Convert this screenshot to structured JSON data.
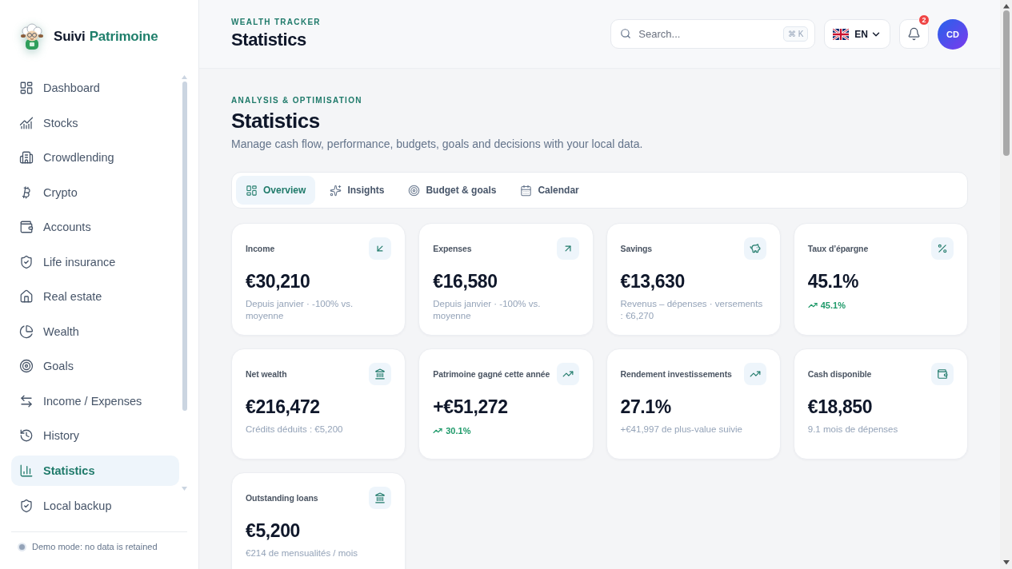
{
  "sidebar": {
    "brand": {
      "first": "Suivi",
      "second": "Patrimoine"
    },
    "nav": [
      {
        "label": "Dashboard",
        "selected": false
      },
      {
        "label": "Stocks",
        "selected": false
      },
      {
        "label": "Crowdlending",
        "selected": false
      },
      {
        "label": "Crypto",
        "selected": false
      },
      {
        "label": "Accounts",
        "selected": false
      },
      {
        "label": "Life insurance",
        "selected": false
      },
      {
        "label": "Real estate",
        "selected": false
      },
      {
        "label": "Wealth",
        "selected": false
      },
      {
        "label": "Goals",
        "selected": false
      },
      {
        "label": "Income / Expenses",
        "selected": false
      },
      {
        "label": "History",
        "selected": false
      },
      {
        "label": "Statistics",
        "selected": true
      }
    ],
    "backup_link": "Local backup",
    "demo_notice": "Demo mode: no data is retained"
  },
  "header": {
    "eyebrow": "WEALTH TRACKER",
    "title": "Statistics",
    "search": {
      "placeholder": "Search...",
      "shortcut": "⌘ K"
    },
    "language": "EN",
    "notifications": {
      "count": "2"
    },
    "avatar": "CD"
  },
  "page": {
    "eyebrow": "ANALYSIS & OPTIMISATION",
    "title": "Statistics",
    "subtitle": "Manage cash flow, performance, budgets, goals and decisions with your local data."
  },
  "tabs": [
    {
      "label": "Overview",
      "selected": true
    },
    {
      "label": "Insights",
      "selected": false
    },
    {
      "label": "Budget & goals",
      "selected": false
    },
    {
      "label": "Calendar",
      "selected": false
    }
  ],
  "cards": [
    {
      "kind": "note",
      "label": "Income",
      "value": "€30,210",
      "note": "Depuis janvier · -100% vs. moyenne"
    },
    {
      "kind": "note",
      "label": "Expenses",
      "value": "€16,580",
      "note": "Depuis janvier · -100% vs. moyenne"
    },
    {
      "kind": "note",
      "label": "Savings",
      "value": "€13,630",
      "note": "Revenus – dépenses · versements : €6,270"
    },
    {
      "kind": "trend",
      "label": "Taux d’épargne",
      "value": "45.1%",
      "trend": "45.1%"
    },
    {
      "kind": "note",
      "label": "Net wealth",
      "value": "€216,472",
      "note": "Crédits déduits : €5,200"
    },
    {
      "kind": "trend",
      "label": "Patrimoine gagné cette année",
      "value": "+€51,272",
      "trend": "30.1%"
    },
    {
      "kind": "note",
      "label": "Rendement investissements",
      "value": "27.1%",
      "note": "+€41,997 de plus-value suivie"
    },
    {
      "kind": "note",
      "label": "Cash disponible",
      "value": "€18,850",
      "note": "9.1 mois de dépenses"
    },
    {
      "kind": "note",
      "label": "Outstanding loans",
      "value": "€5,200",
      "note": "€214 de mensualités / mois"
    }
  ]
}
